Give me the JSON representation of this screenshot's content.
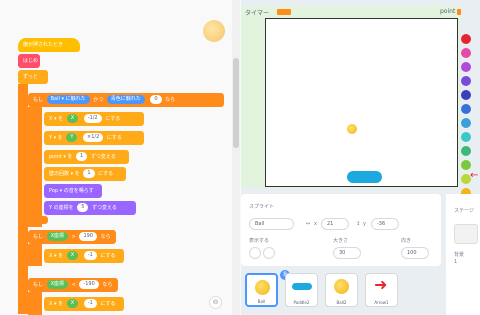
{
  "code_area": {
    "hat_label": "旗が押されたとき",
    "block_a": "はじめ",
    "block_b": "ずっと",
    "if1": {
      "prefix": "もし",
      "sensor": "Ball ▾ に触れた",
      "op": "かつ",
      "cond": "青色に触れた",
      "val": "0",
      "suffix": "なら"
    },
    "x_row": {
      "label": "X ▾",
      "at": "を",
      "v1": "X",
      "op": "-1/2",
      "tail": "にする"
    },
    "y_row": {
      "label": "Y ▾",
      "at": "を",
      "v1": "Y",
      "op": "×1/2",
      "tail": "にする"
    },
    "point_row": {
      "label": "point ▾",
      "at": "を",
      "v": "1",
      "tail": "ずつ変える"
    },
    "hit_row": {
      "label": "壁の回数 ▾",
      "at": "を",
      "v": "1",
      "tail": "にする"
    },
    "pen_row": {
      "label": "Pop ▾",
      "tail": "の音を鳴らす"
    },
    "x_change": {
      "label": "Y",
      "tail": "の座標を",
      "v": "5",
      "tail2": "ずつ変える"
    },
    "if2": {
      "prefix": "もし",
      "l": "X座標",
      "op": ">",
      "v": "190",
      "suffix": "なら"
    },
    "if2_body": {
      "label": "X ▾",
      "at": "を",
      "v1": "X",
      "op": "-1",
      "tail": "にする"
    },
    "if3": {
      "prefix": "もし",
      "l": "X座標",
      "op": "<",
      "v": "-190",
      "suffix": "なら"
    },
    "if3_body": {
      "label": "X ▾",
      "at": "を",
      "v1": "X",
      "op": "-1",
      "tail": "にする"
    },
    "zoom": "⊖"
  },
  "stage": {
    "timer_label": "タイマー",
    "point_label": "point"
  },
  "colors": [
    "#e6262f",
    "#e64aa8",
    "#b04ad8",
    "#7a4ad8",
    "#3b3fb8",
    "#3b6fd8",
    "#3ba0d8",
    "#3bc8c8",
    "#3bb87a",
    "#7ac83b",
    "#b8d83b",
    "#f4b21b"
  ],
  "sprite_panel": {
    "sprite_label": "スプライト",
    "sprite_name": "Ball",
    "x_label": "x",
    "x_value": "21",
    "y_label": "y",
    "y_value": "-36",
    "show_label": "表示する",
    "size_label": "大きさ",
    "size_value": "30",
    "dir_label": "向き",
    "dir_value": "100"
  },
  "stage_side": {
    "title": "ステージ",
    "bg_label": "背景",
    "bg_count": "1"
  },
  "sprites": [
    {
      "name": "Ball",
      "selected": true
    },
    {
      "name": "Paddle2"
    },
    {
      "name": "Ball2"
    },
    {
      "name": "Arrow1"
    }
  ],
  "badge": "8"
}
